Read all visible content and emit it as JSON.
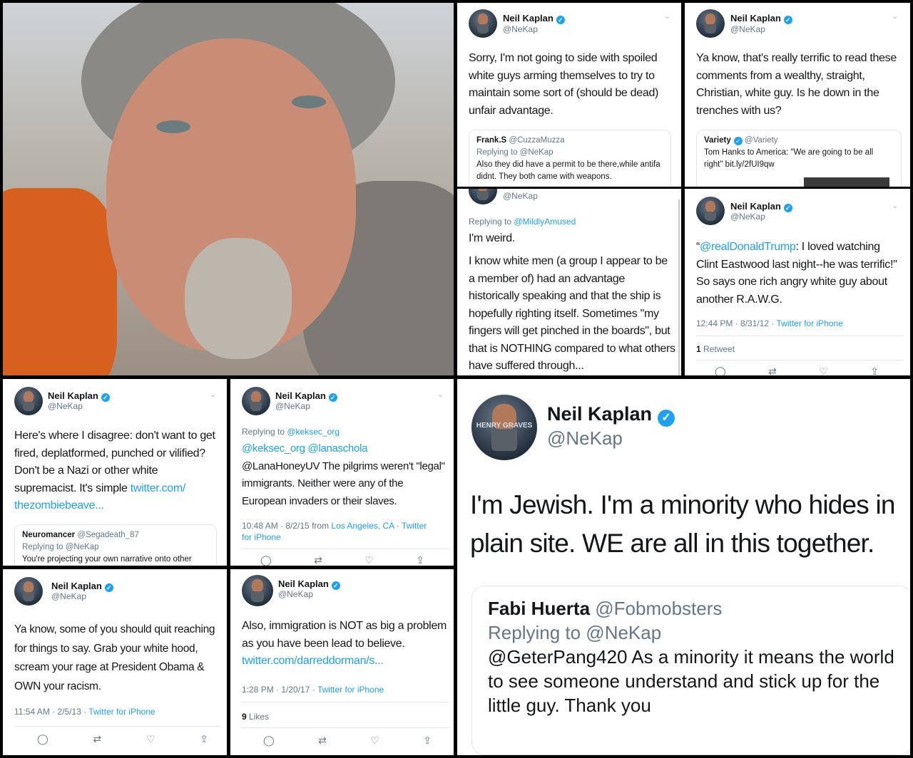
{
  "profile": {
    "name": "Neil Kaplan",
    "handle": "@NeKap",
    "verified_mark": "✓",
    "chevron": "⌄"
  },
  "icons": {
    "reply": "reply-icon",
    "retweet": "retweet-icon",
    "like": "heart-icon",
    "share": "share-icon"
  },
  "action_glyphs": {
    "reply": "◯",
    "retweet": "⇄",
    "like": "♡",
    "share": "⇪"
  },
  "t1": {
    "text": "Sorry, I'm not going to side with spoiled white guys arming themselves to try to maintain some sort of (should be dead) unfair advantage.",
    "quote_name": "Frank.S",
    "quote_handle": "@CuzzaMuzza",
    "quote_reply": "Replying to @NeKap",
    "quote_text": "Also they did have a permit to be there,while antifa didnt. They both came with weapons."
  },
  "t2": {
    "text": "Ya know, that's really terrific to read these comments from a wealthy, straight, Christian, white guy. Is he down in the trenches with us?",
    "quote_name": "Variety",
    "quote_handle": "@Variety",
    "quote_text": "Tom Hanks to America: \"We are going to be all right\" bit.ly/2fUI9qw"
  },
  "t3": {
    "handle": "@NeKap",
    "reply_prefix": "Replying to ",
    "reply_to": "@MildlyAmused",
    "line1": "I'm weird.",
    "text": "I know white men (a group I appear to be a member of) had an advantage historically speaking and that the ship is hopefully righting itself. Sometimes \"my fingers will get pinched in the boards\", but that is NOTHING compared to what others have suffered through..."
  },
  "t4": {
    "mention": "@realDonaldTrump",
    "open_quote": "“",
    "text": ": I loved watching Clint Eastwood last night--he was terrific!\" So says one rich angry white guy about another R.A.W.G.",
    "time": "12:44 PM · 8/31/12 · ",
    "source": "Twitter for iPhone",
    "retweets_count": "1",
    "retweets_label": " Retweet"
  },
  "t5": {
    "text": "Here's where I disagree: don't want to get fired, deplatformed, punched or vilified? Don't be a Nazi or other white supremacist. It's simple ",
    "link": "twitter.com/ thezombiebeave...",
    "quote_name": "Neuromancer",
    "quote_handle": "@Segadeath_87",
    "quote_reply": "Replying to @NeKap",
    "quote_text": "You're projecting your own narrative onto other"
  },
  "t6": {
    "reply_prefix": "Replying to ",
    "reply_to": "@keksec_org",
    "mentions": "@keksec_org @lanaschola",
    "text": "@LanaHoneyUV The pilgrims weren't \"legal\" immigrants. Neither were any of the European invaders or their slaves.",
    "time": "10:48 AM · 8/2/15 from ",
    "place": "Los Angeles, CA",
    "sep": " · ",
    "source": "Twitter for iPhone"
  },
  "t7": {
    "text": "Ya know, some of you should quit reaching for things to say. Grab your white hood, scream your rage at President Obama & OWN your racism.",
    "time": "11:54 AM · 2/5/13 · ",
    "source": "Twitter for iPhone"
  },
  "t8": {
    "text": "Also, immigration is NOT as big a problem as you have been lead to believe. ",
    "link": "twitter.com/darreddorman/s...",
    "time": "1:28 PM · 1/20/17 · ",
    "source": "Twitter for iPhone",
    "likes_count": "9",
    "likes_label": " Likes"
  },
  "t9": {
    "text": "I'm Jewish. I'm a minority who hides in plain site. WE are all in this together.",
    "quote_name": "Fabi Huerta",
    "quote_handle": "@Fobmobsters",
    "quote_reply": "Replying to @NeKap",
    "quote_text": "@GeterPang420 As a minority it means the world to see someone understand and stick up for the little guy. Thank you"
  },
  "avatar_badge": "HENRY GRAVES",
  "colors": {
    "link": "#1da1f2",
    "grey": "#657786",
    "border": "#e1e8ed"
  }
}
